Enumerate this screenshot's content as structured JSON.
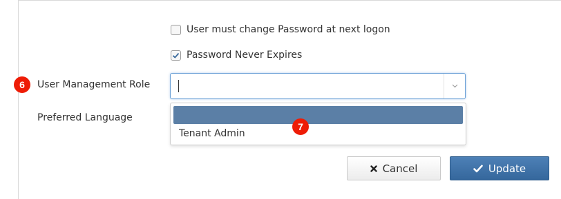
{
  "form": {
    "must_change_password_label": "User must change Password at next logon",
    "never_expires_label": "Password Never Expires",
    "user_management_role_label": "User Management Role",
    "preferred_language_label": "Preferred Language",
    "role_select_value": ""
  },
  "dropdown": {
    "options": [
      "",
      "Tenant Admin"
    ]
  },
  "badges": {
    "step6": "6",
    "step7": "7"
  },
  "buttons": {
    "cancel_label": "Cancel",
    "update_label": "Update"
  },
  "colors": {
    "badge": "#ee1c06",
    "update_button": "#3f72a8",
    "highlight_option": "#5b7fa6",
    "focus_border": "#6aa0d6"
  },
  "state": {
    "must_change_password_checked": false,
    "never_expires_checked": true
  }
}
